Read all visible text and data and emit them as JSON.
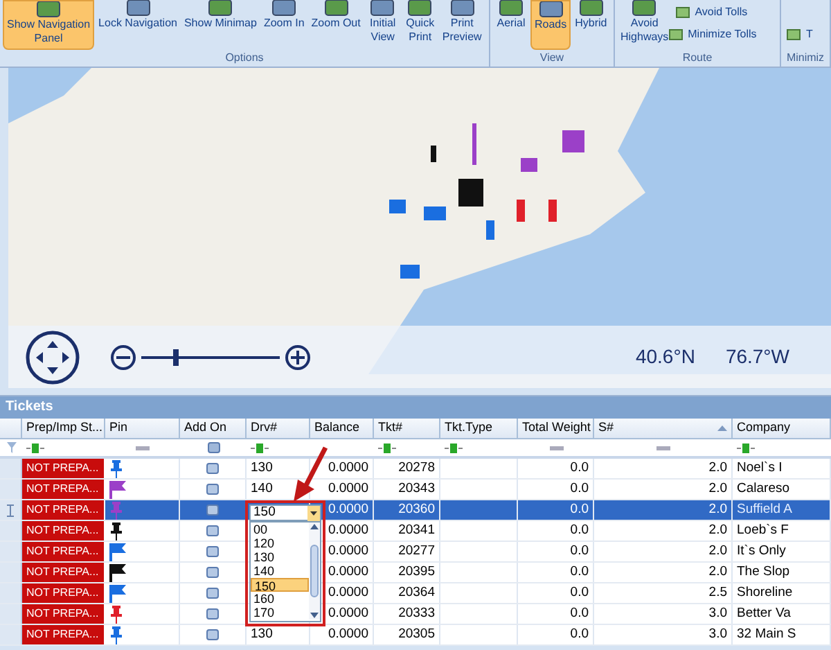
{
  "ribbon": {
    "groups": [
      {
        "label": "Options",
        "buttons": [
          {
            "label": "Show Navigation\nPanel",
            "kind": "large",
            "selected": true
          },
          {
            "label": "Lock Navigation",
            "kind": "large",
            "selected": false
          },
          {
            "label": "Show Minimap",
            "kind": "large",
            "selected": false
          },
          {
            "label": "Zoom In",
            "kind": "large",
            "selected": false
          },
          {
            "label": "Zoom Out",
            "kind": "large",
            "selected": false
          },
          {
            "label": "Initial\nView",
            "kind": "large",
            "selected": false
          },
          {
            "label": "Quick\nPrint",
            "kind": "large",
            "selected": false
          },
          {
            "label": "Print\nPreview",
            "kind": "large",
            "selected": false
          }
        ]
      },
      {
        "label": "View",
        "buttons": [
          {
            "label": "Aerial",
            "kind": "large",
            "selected": false
          },
          {
            "label": "Roads",
            "kind": "large",
            "selected": true
          },
          {
            "label": "Hybrid",
            "kind": "large",
            "selected": false
          }
        ]
      },
      {
        "label": "Route",
        "buttons": [
          {
            "label": "Avoid\nHighways",
            "kind": "large",
            "selected": false
          },
          {
            "label": "Avoid Tolls",
            "kind": "small",
            "selected": false
          },
          {
            "label": "Minimize Tolls",
            "kind": "small",
            "selected": false
          }
        ]
      },
      {
        "label": "Minimiz",
        "buttons": [
          {
            "label": "T",
            "kind": "small",
            "selected": false
          }
        ]
      }
    ]
  },
  "map": {
    "zoom": {
      "level": 0.25
    },
    "coordinates": [
      "40.6°N",
      "76.7°W"
    ]
  },
  "tickets": {
    "title": "Tickets",
    "columns": [
      {
        "label": "Prep/Imp St...",
        "filter": {
          "kind": "text"
        }
      },
      {
        "label": "Pin",
        "filter": {
          "kind": "none"
        }
      },
      {
        "label": "Add On",
        "filter": {
          "kind": "button"
        }
      },
      {
        "label": "Drv#",
        "filter": {
          "kind": "text"
        }
      },
      {
        "label": "Balance"
      },
      {
        "label": "Tkt#",
        "filter": {
          "kind": "text"
        }
      },
      {
        "label": "Tkt.Type",
        "filter": {
          "kind": "text"
        }
      },
      {
        "label": "Total Weight",
        "filter": {
          "kind": "none"
        }
      },
      {
        "label": "S#",
        "filter": {
          "kind": "none"
        },
        "sorted": true
      },
      {
        "label": "Company",
        "filter": {
          "kind": "text"
        }
      }
    ],
    "rows": [
      {
        "status": "NOT PREPA...",
        "pin": {
          "kind": "pushpin",
          "color": "#1a6ee0"
        },
        "drv": "130",
        "balance": "0.0000",
        "tkt": "20278",
        "weight": "0.0",
        "s": "2.0",
        "company": "Noel`s I",
        "selected": false
      },
      {
        "status": "NOT PREPA...",
        "pin": {
          "kind": "flag",
          "color": "#9b40c8"
        },
        "drv": "140",
        "balance": "0.0000",
        "tkt": "20343",
        "weight": "0.0",
        "s": "2.0",
        "company": "Calareso",
        "selected": false
      },
      {
        "status": "NOT PREPA...",
        "pin": {
          "kind": "pushpin",
          "color": "#9b40c8"
        },
        "balance": "0.0000",
        "tkt": "20360",
        "weight": "0.0",
        "s": "2.0",
        "company": "Suffield A",
        "selected": true
      },
      {
        "status": "NOT PREPA...",
        "pin": {
          "kind": "pushpin",
          "color": "#111111"
        },
        "balance": "0.0000",
        "tkt": "20341",
        "weight": "0.0",
        "s": "2.0",
        "company": "Loeb`s F",
        "selected": false
      },
      {
        "status": "NOT PREPA...",
        "pin": {
          "kind": "flag",
          "color": "#1a6ee0"
        },
        "balance": "0.0000",
        "tkt": "20277",
        "weight": "0.0",
        "s": "2.0",
        "company": "It`s Only",
        "selected": false
      },
      {
        "status": "NOT PREPA...",
        "pin": {
          "kind": "flag",
          "color": "#111111"
        },
        "balance": "0.0000",
        "tkt": "20395",
        "weight": "0.0",
        "s": "2.0",
        "company": "The Slop",
        "selected": false
      },
      {
        "status": "NOT PREPA...",
        "pin": {
          "kind": "flag",
          "color": "#1a6ee0"
        },
        "balance": "0.0000",
        "tkt": "20364",
        "weight": "0.0",
        "s": "2.5",
        "company": "Shoreline",
        "selected": false
      },
      {
        "status": "NOT PREPA...",
        "pin": {
          "kind": "pushpin",
          "color": "#e0202a"
        },
        "balance": "0.0000",
        "tkt": "20333",
        "weight": "0.0",
        "s": "3.0",
        "company": "Better Va",
        "selected": false
      },
      {
        "status": "NOT PREPA...",
        "pin": {
          "kind": "pushpin",
          "color": "#1a6ee0"
        },
        "drv": "130",
        "balance": "0.0000",
        "tkt": "20305",
        "weight": "0.0",
        "s": "3.0",
        "company": "32 Main S",
        "selected": false
      }
    ],
    "dropdown": {
      "value": "150",
      "options": [
        {
          "label": "00",
          "selected": false
        },
        {
          "label": "120",
          "selected": false
        },
        {
          "label": "130",
          "selected": false
        },
        {
          "label": "140",
          "selected": false
        },
        {
          "label": "150",
          "selected": true
        },
        {
          "label": "160",
          "selected": false
        },
        {
          "label": "170",
          "selected": false
        }
      ]
    }
  }
}
